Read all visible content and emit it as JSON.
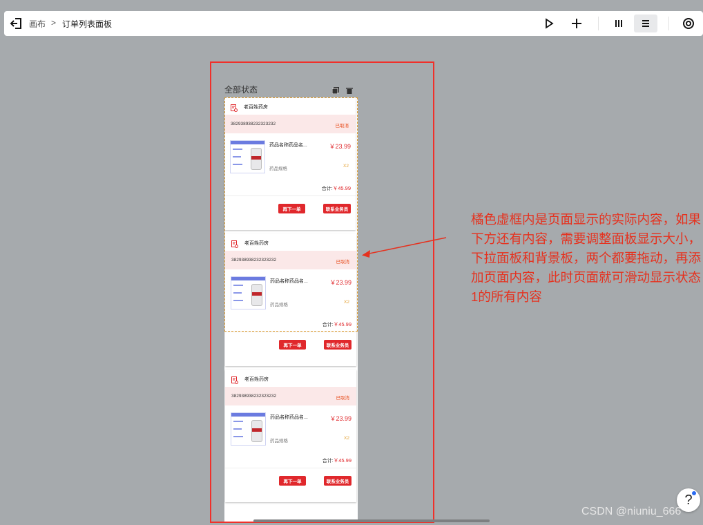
{
  "toolbar": {
    "breadcrumb_root": "画布",
    "breadcrumb_sep": ">",
    "breadcrumb_current": "订单列表面板",
    "icons": [
      "back-icon",
      "play-icon",
      "plus-icon",
      "columns-icon",
      "list-icon",
      "target-icon"
    ]
  },
  "page": {
    "status_title": "全部状态",
    "cards": [
      {
        "store": "老百姓药房",
        "order_no": "382938938232323232",
        "state": "已取消",
        "product_name": "药品名称药品名...",
        "price": "￥23.99",
        "spec": "药品规格",
        "qty": "X2",
        "total_label": "合计:",
        "total_value": "￥45.99",
        "btn_again": "再下一单",
        "btn_contact": "联系业务员"
      },
      {
        "store": "老百姓药房",
        "order_no": "382938938232323232",
        "state": "已取消",
        "product_name": "药品名称药品名...",
        "price": "￥23.99",
        "spec": "药品规格",
        "qty": "X2",
        "total_label": "合计:",
        "total_value": "￥45.99",
        "btn_again": "再下一单",
        "btn_contact": "联系业务员"
      },
      {
        "store": "老百姓药房",
        "order_no": "382938938232323232",
        "state": "已取消",
        "product_name": "药品名称药品名...",
        "price": "￥23.99",
        "spec": "药品规格",
        "qty": "X2",
        "total_label": "合计:",
        "total_value": "￥45.99",
        "btn_again": "再下一单",
        "btn_contact": "联系业务员"
      }
    ]
  },
  "annotation": {
    "text": "橘色虚框内是页面显示的实际内容，如果下方还有内容，需要调整面板显示大小，下拉面板和背景板，两个都要拖动，再添加页面内容，此时页面就可滑动显示状态1的所有内容"
  },
  "help": {
    "label": "?"
  },
  "watermark": "CSDN @niuniu_666",
  "colors": {
    "accent": "#e0282c",
    "frame": "#f0302a",
    "selection": "#e3a032",
    "annotation": "#e5321f"
  }
}
